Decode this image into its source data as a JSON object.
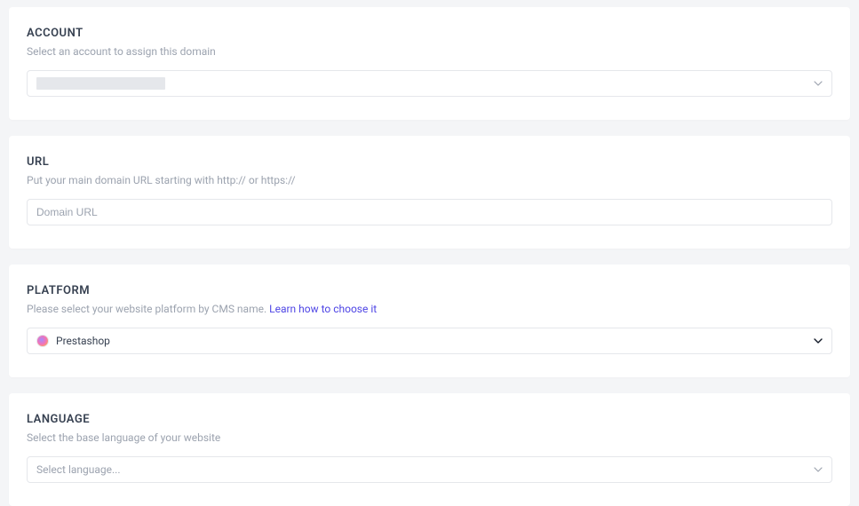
{
  "account": {
    "title": "ACCOUNT",
    "description": "Select an account to assign this domain",
    "selected": ""
  },
  "url": {
    "title": "URL",
    "description": "Put your main domain URL starting with http:// or https://",
    "placeholder": "Domain URL",
    "value": ""
  },
  "platform": {
    "title": "PLATFORM",
    "description": "Please select your website platform by CMS name. ",
    "link_text": "Learn how to choose it",
    "selected": "Prestashop",
    "icon": "prestashop-icon"
  },
  "language": {
    "title": "LANGUAGE",
    "description": "Select the base language of your website",
    "placeholder": "Select language..."
  }
}
